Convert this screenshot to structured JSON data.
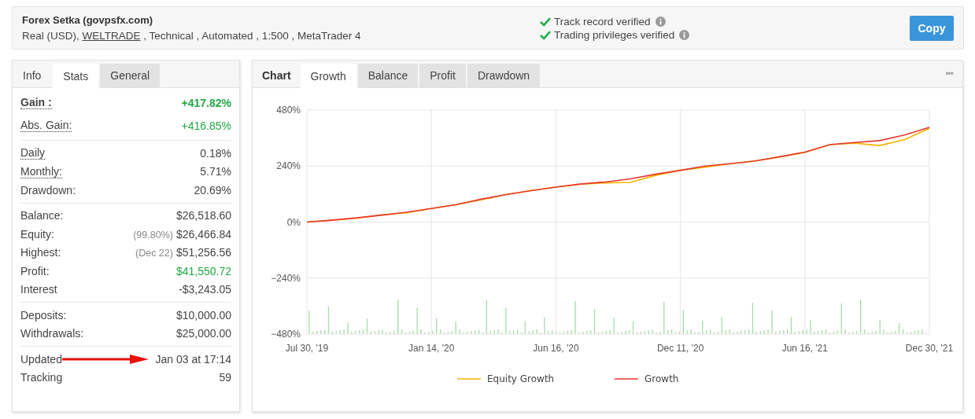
{
  "header": {
    "title": "Forex Setka (govpsfx.com)",
    "details": [
      {
        "text": "Real (USD), ",
        "link": false
      },
      {
        "text": "WELTRADE",
        "link": true
      },
      {
        "text": " , Technical , Automated , 1:500 , MetaTrader 4",
        "link": false
      }
    ],
    "verifications": [
      {
        "label": "Track record verified",
        "verified": true
      },
      {
        "label": "Trading privileges verified",
        "verified": true
      }
    ],
    "button": "Copy"
  },
  "stats_panel": {
    "tabs": [
      {
        "label": "Info",
        "selected": false,
        "shaded": false
      },
      {
        "label": "Stats",
        "selected": true,
        "shaded": false
      },
      {
        "label": "General",
        "selected": false,
        "shaded": true
      }
    ],
    "groups": [
      [
        {
          "label": "Gain :",
          "value": "+417.82%",
          "emphasis": true,
          "dotted": true,
          "positive": true,
          "arrow": false
        },
        {
          "label": "Abs. Gain:",
          "value": "+416.85%",
          "emphasis": false,
          "dotted": true,
          "positive": true,
          "arrow": false
        }
      ],
      [
        {
          "label": "Daily",
          "value": "0.18%",
          "emphasis": false,
          "dotted": true,
          "positive": false,
          "arrow": false
        },
        {
          "label": "Monthly:",
          "value": "5.71%",
          "emphasis": false,
          "dotted": true,
          "positive": false,
          "arrow": false
        },
        {
          "label": "Drawdown:",
          "value": "20.69%",
          "emphasis": false,
          "dotted": false,
          "positive": false,
          "arrow": false
        }
      ],
      [
        {
          "label": "Balance:",
          "value": "$26,518.60",
          "emphasis": false,
          "dotted": false,
          "positive": false,
          "arrow": false
        },
        {
          "label": "Equity:",
          "value": "$26,466.84",
          "note": "(99.80%)",
          "emphasis": false,
          "dotted": false,
          "positive": false,
          "arrow": false
        },
        {
          "label": "Highest:",
          "value": "$51,256.56",
          "note": "(Dec 22)",
          "emphasis": false,
          "dotted": false,
          "positive": false,
          "arrow": false
        },
        {
          "label": "Profit:",
          "value": "$41,550.72",
          "emphasis": false,
          "dotted": false,
          "positive": true,
          "arrow": false
        },
        {
          "label": "Interest",
          "value": "-$3,243.05",
          "emphasis": false,
          "dotted": false,
          "positive": false,
          "arrow": false
        }
      ],
      [
        {
          "label": "Deposits:",
          "value": "$10,000.00",
          "emphasis": false,
          "dotted": false,
          "positive": false,
          "arrow": false
        },
        {
          "label": "Withdrawals:",
          "value": "$25,000.00",
          "emphasis": false,
          "dotted": false,
          "positive": false,
          "arrow": false
        }
      ],
      [
        {
          "label": "Updated",
          "value": "Jan 03 at 17:14",
          "emphasis": false,
          "dotted": false,
          "positive": false,
          "arrow": true
        },
        {
          "label": "Tracking",
          "value": "59",
          "emphasis": false,
          "dotted": false,
          "positive": false,
          "arrow": false
        }
      ]
    ]
  },
  "chart_panel": {
    "label": "Chart",
    "more": "•••",
    "tabs": [
      {
        "label": "Growth",
        "selected": true,
        "shaded": false
      },
      {
        "label": "Balance",
        "selected": false,
        "shaded": true
      },
      {
        "label": "Profit",
        "selected": false,
        "shaded": true
      },
      {
        "label": "Drawdown",
        "selected": false,
        "shaded": true
      }
    ],
    "chart_data": {
      "type": "line",
      "categories": [
        "Jul 30, '19",
        null,
        null,
        null,
        null,
        "Jan 14, '20",
        null,
        null,
        null,
        null,
        "Jun 16, '20",
        null,
        null,
        null,
        null,
        "Dec 11, '20",
        null,
        null,
        null,
        null,
        "Jun 16, '21",
        null,
        null,
        null,
        null,
        "Dec 30, '21"
      ],
      "series": [
        {
          "name": "Equity Growth",
          "color": "#f5b400",
          "values": [
            0,
            8,
            17,
            30,
            40,
            58,
            75,
            95,
            118,
            135,
            150,
            163,
            168,
            170,
            200,
            222,
            235,
            250,
            262,
            280,
            298,
            332,
            338,
            328,
            353,
            402
          ]
        },
        {
          "name": "Growth",
          "color": "#e8382c",
          "values": [
            0,
            8,
            18,
            30,
            42,
            58,
            75,
            98,
            118,
            135,
            150,
            163,
            172,
            185,
            205,
            222,
            240,
            250,
            262,
            280,
            300,
            332,
            341,
            349,
            373,
            406
          ]
        }
      ],
      "ylim": [
        -480,
        480
      ],
      "grid": true,
      "legend": true,
      "yticks": [
        {
          "value": 480,
          "label": "480%"
        },
        {
          "value": 240,
          "label": "240%"
        },
        {
          "value": 0,
          "label": "0%"
        },
        {
          "value": -240,
          "label": "−240%"
        },
        {
          "value": -480,
          "label": "−480%"
        }
      ]
    }
  }
}
